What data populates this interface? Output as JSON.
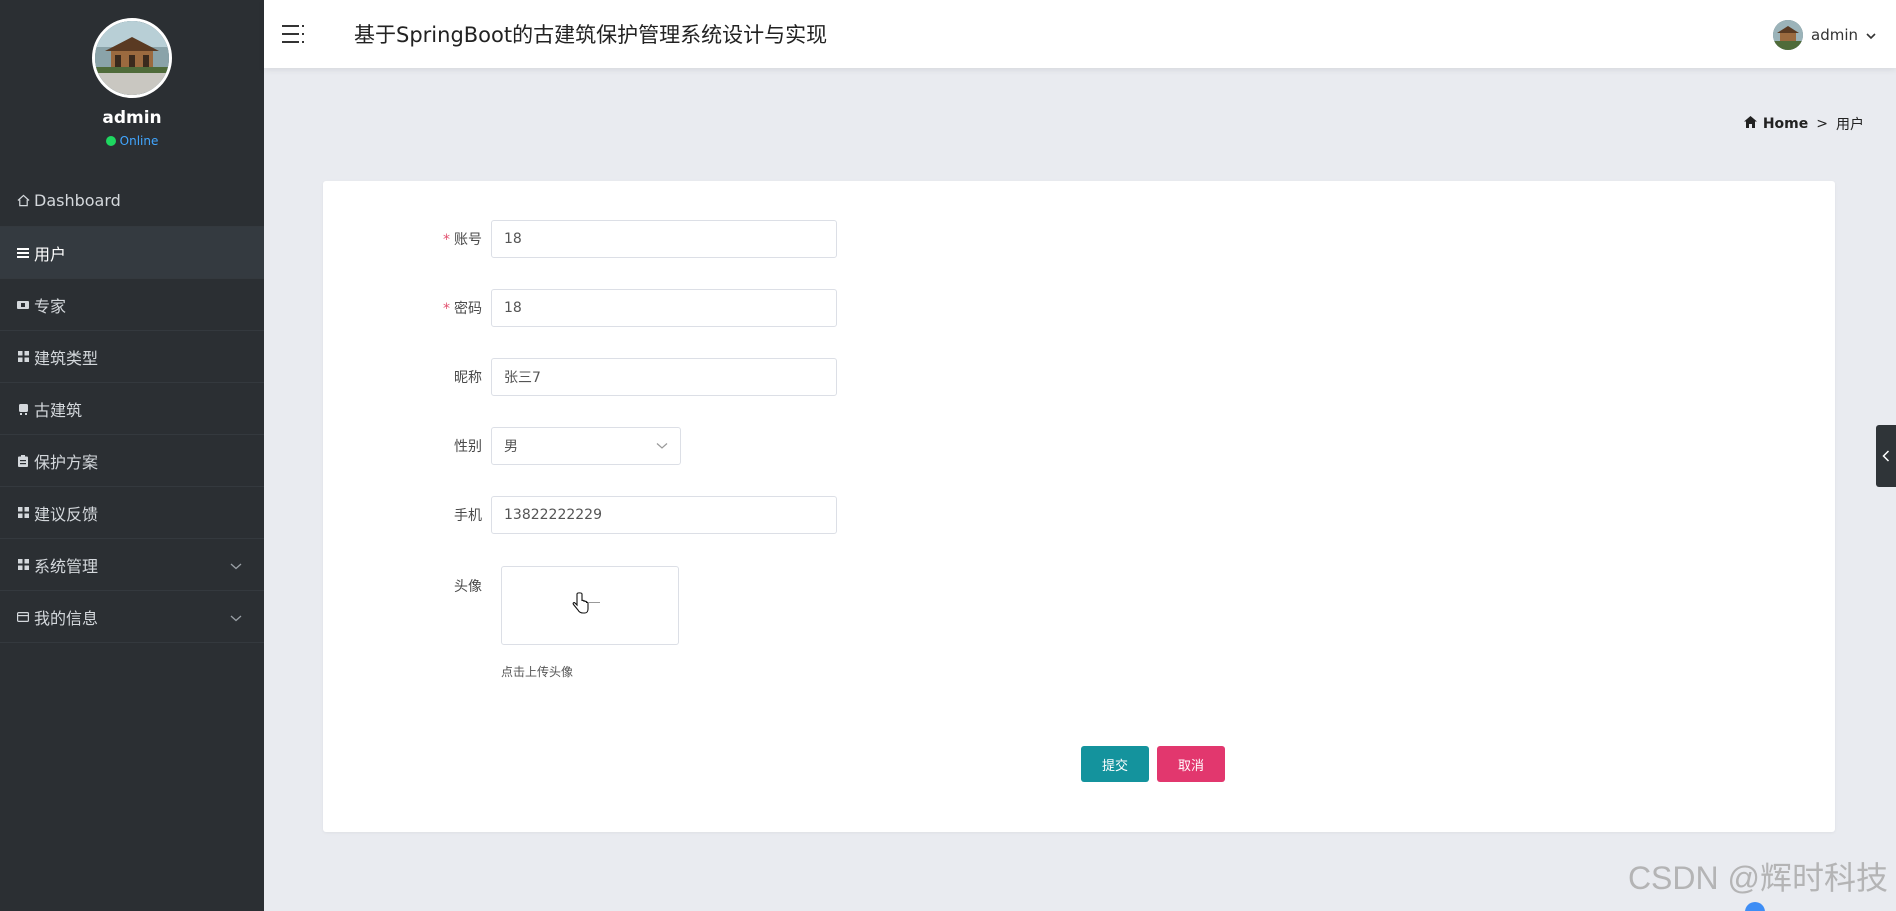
{
  "sidebar": {
    "username": "admin",
    "status": "Online",
    "items": [
      {
        "label": "Dashboard",
        "icon": "home-icon",
        "active": false,
        "expandable": false
      },
      {
        "label": "用户",
        "icon": "list-icon",
        "active": true,
        "expandable": false
      },
      {
        "label": "专家",
        "icon": "ticket-icon",
        "active": false,
        "expandable": false
      },
      {
        "label": "建筑类型",
        "icon": "grid-icon",
        "active": false,
        "expandable": false
      },
      {
        "label": "古建筑",
        "icon": "building-icon",
        "active": false,
        "expandable": false
      },
      {
        "label": "保护方案",
        "icon": "clipboard-icon",
        "active": false,
        "expandable": false
      },
      {
        "label": "建议反馈",
        "icon": "grid-icon",
        "active": false,
        "expandable": false
      },
      {
        "label": "系统管理",
        "icon": "grid-icon",
        "active": false,
        "expandable": true
      },
      {
        "label": "我的信息",
        "icon": "card-icon",
        "active": false,
        "expandable": true
      }
    ]
  },
  "header": {
    "title": "基于SpringBoot的古建筑保护管理系统设计与实现",
    "user": "admin"
  },
  "breadcrumb": {
    "home": "Home",
    "separator": ">",
    "current": "用户"
  },
  "form": {
    "account": {
      "label": "账号",
      "value": "18",
      "required": true
    },
    "password": {
      "label": "密码",
      "value": "18",
      "required": true
    },
    "nickname": {
      "label": "昵称",
      "value": "张三7",
      "required": false
    },
    "gender": {
      "label": "性别",
      "value": "男",
      "required": false
    },
    "phone": {
      "label": "手机",
      "value": "13822222229",
      "required": false
    },
    "avatar": {
      "label": "头像",
      "tip": "点击上传头像"
    },
    "submit_label": "提交",
    "cancel_label": "取消"
  },
  "watermark": "CSDN @辉时科技",
  "colors": {
    "sidebar_bg": "#2b2f33",
    "submit": "#14939d",
    "cancel": "#e2376e",
    "online": "#1ed760"
  }
}
